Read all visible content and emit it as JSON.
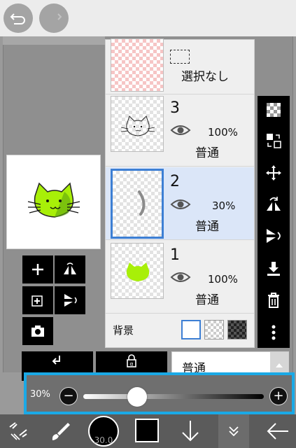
{
  "layers": [
    {
      "name": "選択なし"
    },
    {
      "number": "3",
      "opacity": "100%",
      "blend": "普通"
    },
    {
      "number": "2",
      "opacity": "30%",
      "blend": "普通"
    },
    {
      "number": "1",
      "opacity": "100%",
      "blend": "普通"
    }
  ],
  "background": {
    "label": "背景"
  },
  "blend_mode": {
    "value": "普通"
  },
  "opacity_slider": {
    "label": "30%",
    "value": 30,
    "minus": "−",
    "plus": "+"
  },
  "bottom": {
    "brush_size": "30.0"
  },
  "colors": {
    "accent": "#1aa9e6",
    "selection": "#3d7fd4",
    "cat_green": "#a8ef08",
    "layer_selected_bg": "#dbe6f8"
  },
  "icons": {
    "undo": "undo-icon",
    "redo": "redo-icon",
    "add": "plus-icon",
    "flip_h": "flip-horizontal-icon",
    "add_layer": "add-layer-icon",
    "flip_v": "flip-vertical-icon",
    "camera": "camera-icon",
    "checker": "transparent-icon",
    "swap": "swap-layers-icon",
    "move": "move-icon",
    "rotate": "rotate-icon",
    "merge": "merge-down-icon",
    "delete": "trash-icon",
    "more": "more-icon",
    "clip": "clipping-icon",
    "lock": "alpha-lock-icon",
    "transform": "transform-tool-icon",
    "brush": "brush-icon",
    "down": "arrow-down-icon",
    "collapse": "chevron-double-down-icon",
    "back": "arrow-left-icon"
  }
}
